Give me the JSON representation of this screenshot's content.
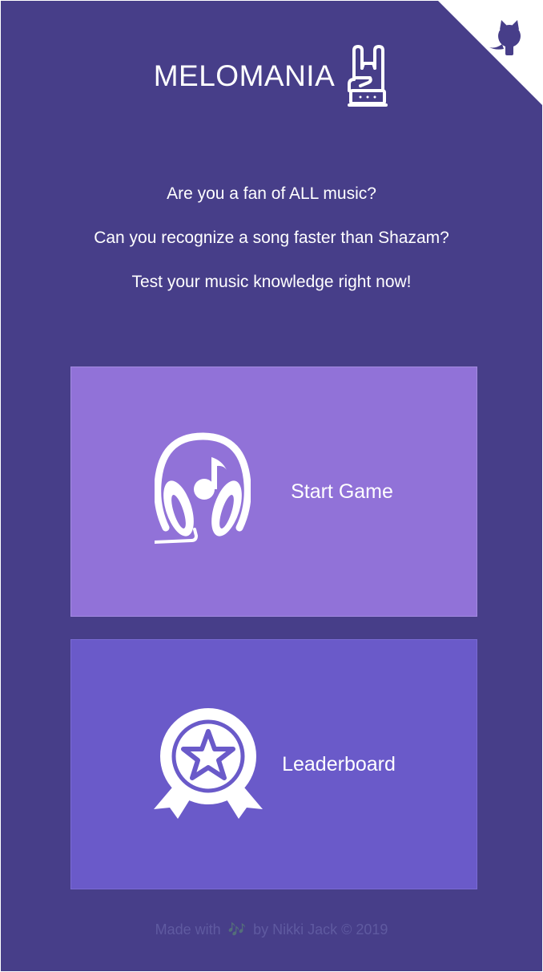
{
  "app": {
    "title": "MELOMANIA",
    "logo_icon": "rock-hand-icon",
    "corner_icon": "github-octocat-icon"
  },
  "intro": {
    "lines": [
      "Are you a fan of ALL music?",
      "Can you recognize a song faster than Shazam?",
      "Test your music knowledge right now!"
    ]
  },
  "menu": {
    "start": {
      "label": "Start Game",
      "icon": "headphones-music-icon"
    },
    "leaderboard": {
      "label": "Leaderboard",
      "icon": "award-badge-icon"
    }
  },
  "footer": {
    "prefix": "Made with",
    "icon": "music-notes-icon",
    "note_glyph": "🎶",
    "suffix": "by Nikki Jack © 2019"
  },
  "colors": {
    "background": "#473e89",
    "start_card": "#9172d8",
    "leaderboard_card": "#6a5ac9",
    "footer_text": "#5f5aa0"
  }
}
